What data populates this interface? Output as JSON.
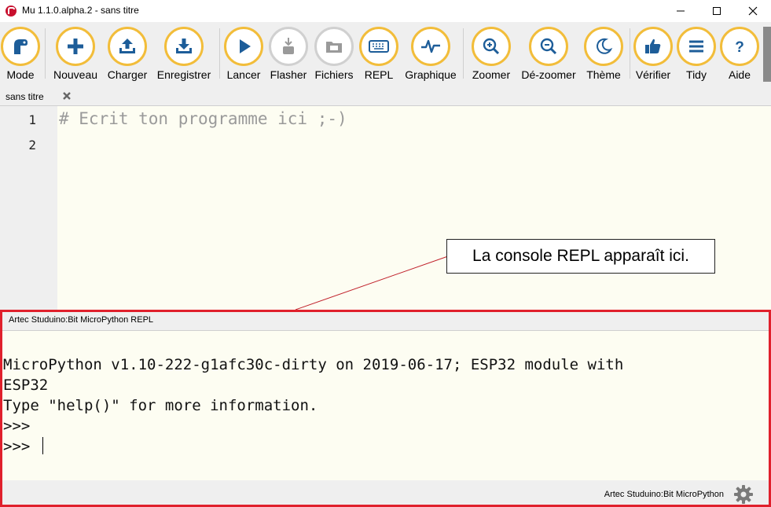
{
  "window": {
    "title": "Mu 1.1.0.alpha.2 - sans titre",
    "minimize_icon": "minimize-icon",
    "maximize_icon": "maximize-icon",
    "close_icon": "close-icon"
  },
  "colors": {
    "accent": "#f2bd3a",
    "icon_blue": "#1d5d99",
    "highlight_border": "#e0202c",
    "editor_bg": "#fdfdf2"
  },
  "toolbar": {
    "buttons": [
      {
        "label": "Mode",
        "icon": "mode-icon"
      },
      {
        "label": "Nouveau",
        "icon": "plus-icon"
      },
      {
        "label": "Charger",
        "icon": "upload-icon"
      },
      {
        "label": "Enregistrer",
        "icon": "download-icon"
      },
      {
        "label": "Lancer",
        "icon": "play-icon"
      },
      {
        "label": "Flasher",
        "icon": "flash-icon"
      },
      {
        "label": "Fichiers",
        "icon": "files-icon"
      },
      {
        "label": "REPL",
        "icon": "keyboard-icon"
      },
      {
        "label": "Graphique",
        "icon": "plotter-icon"
      },
      {
        "label": "Zoomer",
        "icon": "zoom-in-icon"
      },
      {
        "label": "Dé-zoomer",
        "icon": "zoom-out-icon"
      },
      {
        "label": "Thème",
        "icon": "moon-icon"
      },
      {
        "label": "Vérifier",
        "icon": "thumbs-up-icon"
      },
      {
        "label": "Tidy",
        "icon": "lines-icon"
      },
      {
        "label": "Aide",
        "icon": "question-icon"
      }
    ]
  },
  "tabs": [
    {
      "label": "sans titre",
      "close_icon": "close-icon"
    }
  ],
  "editor": {
    "line_numbers": [
      "1",
      "2"
    ],
    "code": "# Ecrit ton programme ici ;-)"
  },
  "annotation": {
    "text": "La console REPL apparaît ici."
  },
  "repl": {
    "title": "Artec Studuino:Bit MicroPython REPL",
    "output": "MicroPython v1.10-222-g1afc30c-dirty on 2019-06-17; ESP32 module with\nESP32\nType \"help()\" for more information.\n>>>\n>>> "
  },
  "statusbar": {
    "mode": "Artec Studuino:Bit MicroPython",
    "settings_icon": "gear-icon"
  }
}
